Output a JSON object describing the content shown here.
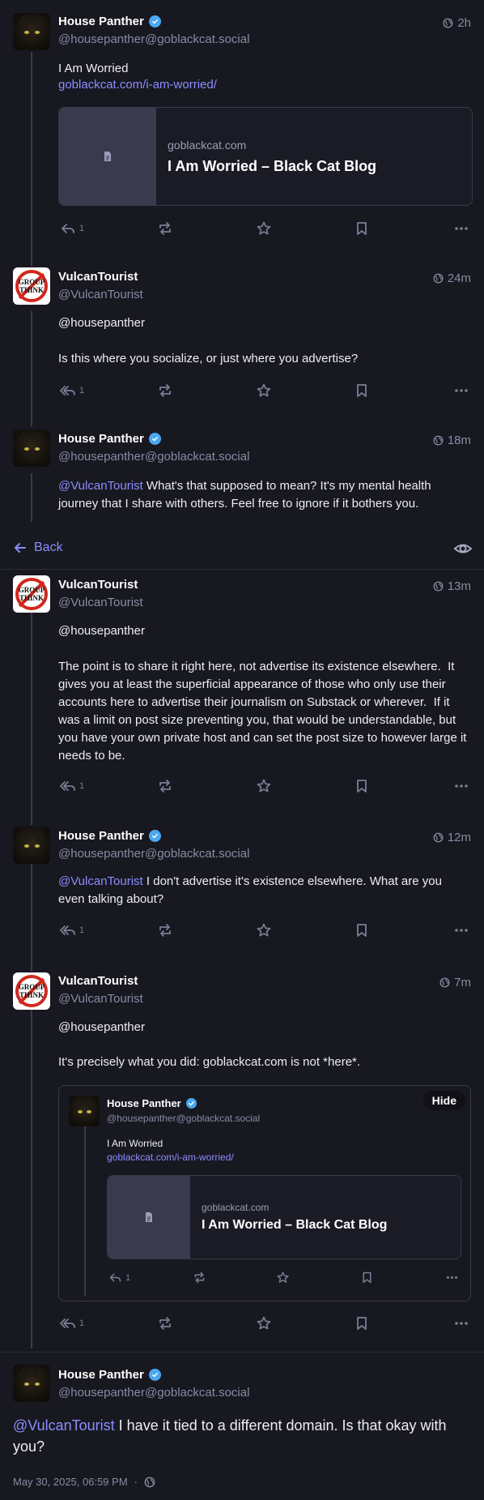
{
  "posts": [
    {
      "author": "House Panther",
      "handle": "@housepanther@goblackcat.social",
      "time": "2h",
      "text": "I Am Worried",
      "link": "goblackcat.com/i-am-worried/",
      "card": {
        "host": "goblackcat.com",
        "title": "I Am Worried – Black Cat Blog"
      },
      "reply_count": "1"
    },
    {
      "author": "VulcanTourist",
      "handle": "@VulcanTourist",
      "time": "24m",
      "mention_line": "@housepanther",
      "text": "Is this where you socialize, or just where you advertise?",
      "reply_count": "1"
    },
    {
      "author": "House Panther",
      "handle": "@housepanther@goblackcat.social",
      "time": "18m",
      "mention": "@VulcanTourist",
      "text": " What's that supposed to mean? It's my mental health journey that I share with others. Feel free to ignore if it bothers you."
    },
    {
      "author": "VulcanTourist",
      "handle": "@VulcanTourist",
      "time": "13m",
      "mention_line": "@housepanther",
      "text": "The point is to share it right here, not advertise its existence elsewhere.  It gives you at least the superficial appearance of those who only use their accounts here to advertise their journalism on Substack or wherever.  If it was a limit on post size preventing you, that would be understandable, but you have your own private host and can set the post size to however large it needs to be.",
      "reply_count": "1"
    },
    {
      "author": "House Panther",
      "handle": "@housepanther@goblackcat.social",
      "time": "12m",
      "mention": "@VulcanTourist",
      "text": " I don't advertise it's existence elsewhere. What are you even talking about?",
      "reply_count": "1"
    },
    {
      "author": "VulcanTourist",
      "handle": "@VulcanTourist",
      "time": "7m",
      "mention_line": "@housepanther",
      "text": "It's precisely what you did: goblackcat.com is not *here*.",
      "reply_count": "1",
      "quote": {
        "author": "House Panther",
        "handle": "@housepanther@goblackcat.social",
        "text": "I Am Worried",
        "link": "goblackcat.com/i-am-worried/",
        "card": {
          "host": "goblackcat.com",
          "title": "I Am Worried – Black Cat Blog"
        },
        "reply_count": "1",
        "hide_label": "Hide"
      }
    },
    {
      "author": "House Panther",
      "handle": "@housepanther@goblackcat.social",
      "mention": "@VulcanTourist",
      "text": " I have it tied to a different domain. Is that okay with you?",
      "date": "May 30, 2025, 06:59 PM",
      "separator": "·"
    }
  ],
  "nav": {
    "back_label": "Back"
  },
  "colors": {
    "accent": "#8c8dff",
    "background": "#181821",
    "verified": "#4aa8f0"
  },
  "icons": [
    "globe-icon",
    "reply-icon",
    "reply-all-icon",
    "boost-icon",
    "star-icon",
    "bookmark-icon",
    "more-icon",
    "document-icon",
    "arrow-left-icon",
    "eye-icon",
    "verified-badge-icon"
  ]
}
